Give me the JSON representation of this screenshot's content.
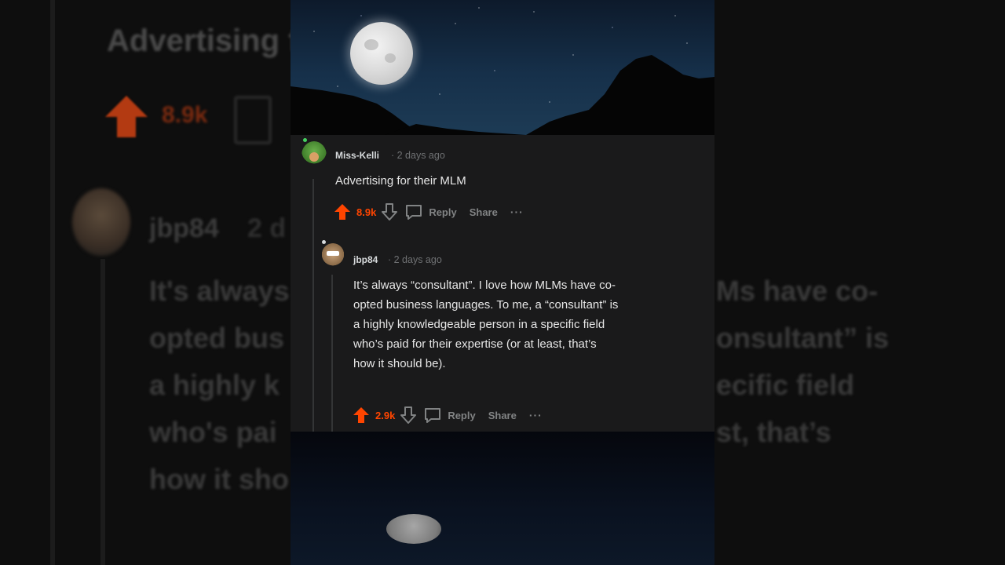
{
  "background": {
    "blurred_comment_header": "Advertising f",
    "blurred_score": "8.9k",
    "blurred_user": "jbp84",
    "blurred_date": "2 d",
    "blurred_lines_left": [
      "It's always",
      "opted bus",
      "a highly k",
      "who's pai",
      "how it sho"
    ],
    "blurred_lines_right": [
      "Ms have co-",
      "onsultant” is",
      "ecific field",
      "st, that’s",
      ""
    ]
  },
  "comment": {
    "author": "Miss-Kelli",
    "timestamp": "· 2 days ago",
    "text": "Advertising for their MLM",
    "score": "8.9k",
    "reply_label": "Reply",
    "share_label": "Share",
    "more_label": "···"
  },
  "reply": {
    "author": "jbp84",
    "timestamp": "· 2 days ago",
    "lines": [
      "It’s always “consultant”. I love how MLMs have co-",
      "opted business languages. To me, a “consultant” is",
      "a highly knowledgeable person in a specific field",
      "who’s paid for their expertise (or at least, that’s",
      "how it should be)."
    ],
    "score": "2.9k",
    "reply_label": "Reply",
    "share_label": "Share",
    "more_label": "···"
  },
  "colors": {
    "upvote": "#ff4500",
    "card_bg": "#1a1a1b",
    "meta": "#818384"
  }
}
